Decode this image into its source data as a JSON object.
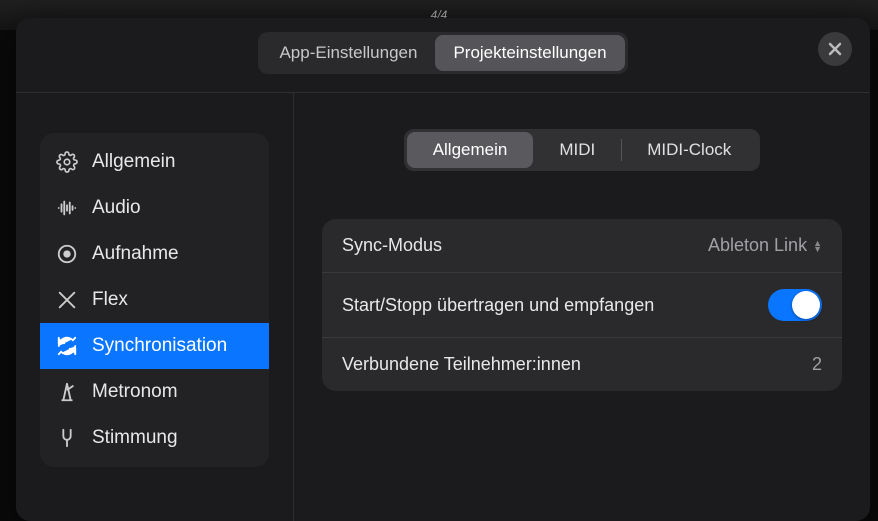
{
  "backdrop": {
    "time_sig": "4/4"
  },
  "header": {
    "tabs": {
      "app": "App-Einstellungen",
      "project": "Projekteinstellungen"
    },
    "active_tab": "project"
  },
  "sidebar": {
    "items": [
      {
        "id": "general",
        "label": "Allgemein",
        "icon": "gear-icon"
      },
      {
        "id": "audio",
        "label": "Audio",
        "icon": "waveform-icon"
      },
      {
        "id": "record",
        "label": "Aufnahme",
        "icon": "record-icon"
      },
      {
        "id": "flex",
        "label": "Flex",
        "icon": "flex-icon"
      },
      {
        "id": "sync",
        "label": "Synchronisation",
        "icon": "sync-icon"
      },
      {
        "id": "metronome",
        "label": "Metronom",
        "icon": "metronome-icon"
      },
      {
        "id": "tuning",
        "label": "Stimmung",
        "icon": "tuning-fork-icon"
      }
    ],
    "active": "sync"
  },
  "sub_tabs": {
    "general": "Allgemein",
    "midi": "MIDI",
    "midi_clock": "MIDI-Clock",
    "active": "general"
  },
  "settings": {
    "sync_mode": {
      "label": "Sync-Modus",
      "value": "Ableton Link"
    },
    "start_stop": {
      "label": "Start/Stopp übertragen und empfangen",
      "value": true
    },
    "participants": {
      "label": "Verbundene Teilnehmer:innen",
      "value": "2"
    }
  },
  "colors": {
    "accent": "#0a76ff"
  }
}
